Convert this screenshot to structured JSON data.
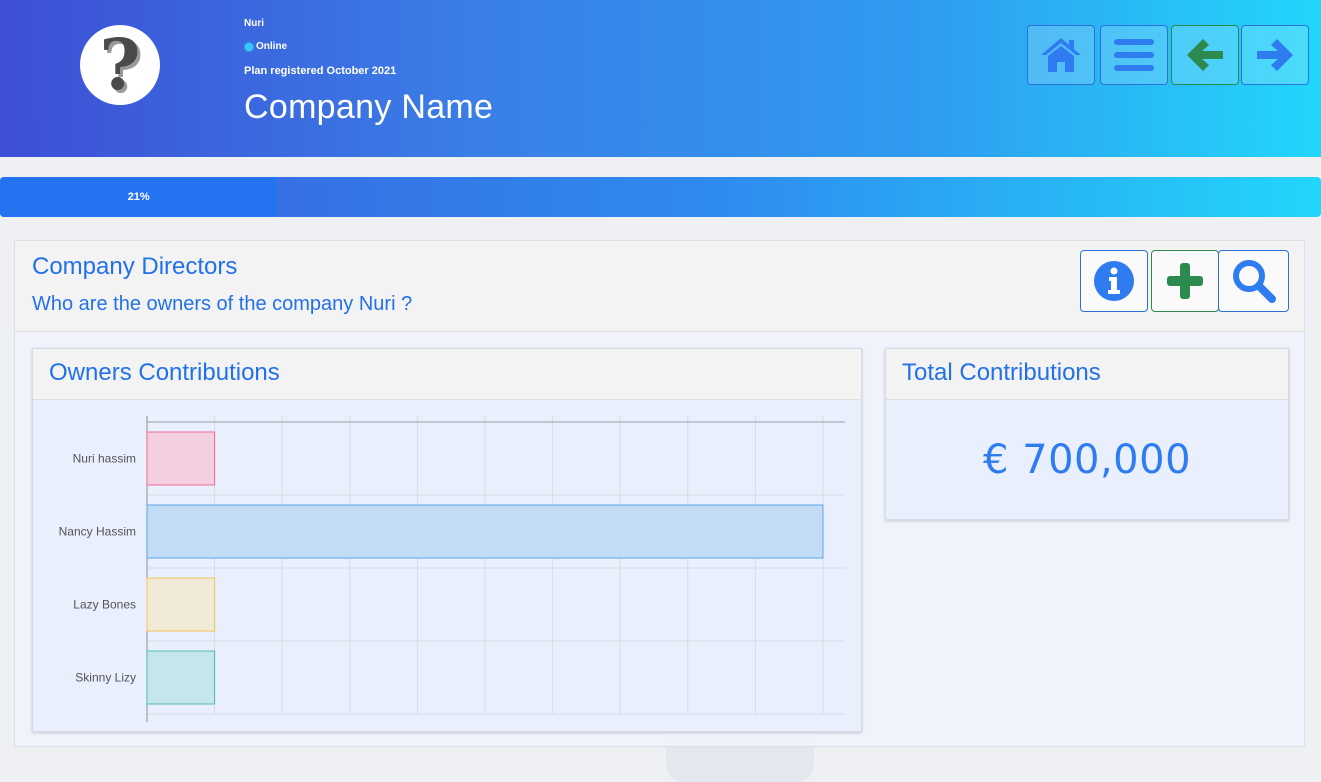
{
  "header": {
    "user_name": "Nuri",
    "status": "Online",
    "plan_text": "Plan registered October 2021",
    "company_name": "Company Name",
    "avatar_icon": "question-mark-icon",
    "nav_buttons": [
      {
        "icon": "home-icon",
        "color": "#2f7cf0"
      },
      {
        "icon": "menu-icon",
        "color": "#2f7cf0"
      },
      {
        "icon": "arrow-left-icon",
        "color": "#2d8a4e"
      },
      {
        "icon": "arrow-right-icon",
        "color": "#2f7cf0"
      }
    ]
  },
  "progress": {
    "value": 0.21,
    "label": "21%"
  },
  "section": {
    "title": "Company Directors",
    "subtitle": "Who are the owners of the company Nuri ?",
    "actions": [
      {
        "icon": "info-icon",
        "color": "#2f7cf0"
      },
      {
        "icon": "plus-icon",
        "color": "#2d8a4e"
      },
      {
        "icon": "search-icon",
        "color": "#2f7cf0"
      }
    ]
  },
  "owners_panel": {
    "title": "Owners Contributions"
  },
  "total_panel": {
    "title": "Total Contributions",
    "value": "€ 700,000"
  },
  "chart_data": {
    "type": "bar",
    "orientation": "horizontal",
    "categories": [
      "Nuri hassim",
      "Nancy Hassim",
      "Lazy Bones",
      "Skinny Lizy"
    ],
    "values": [
      50000,
      500000,
      50000,
      50000
    ],
    "xlim": [
      0,
      500000
    ],
    "grid": true,
    "colors": {
      "fill": [
        "#f3cfe0",
        "#c3dcf5",
        "#f1ead6",
        "#c5e6ea"
      ],
      "stroke": [
        "#ec6b8e",
        "#5aa6e6",
        "#f2c45a",
        "#55b8bb"
      ]
    }
  }
}
